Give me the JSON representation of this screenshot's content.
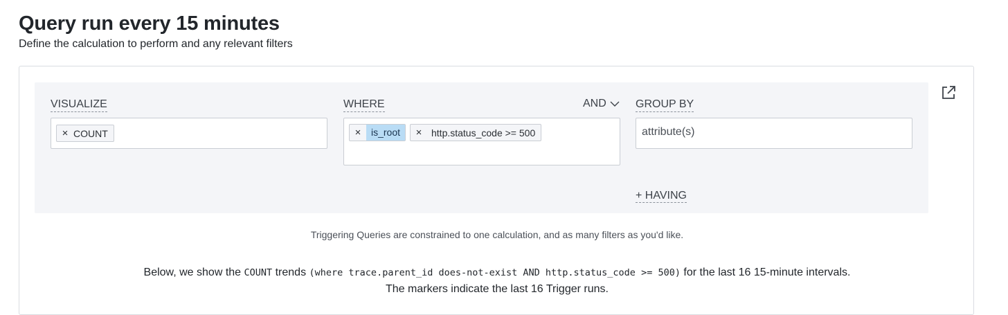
{
  "header": {
    "title": "Query run every 15 minutes",
    "subtitle": "Define the calculation to perform and any relevant filters"
  },
  "builder": {
    "visualize": {
      "label": "VISUALIZE",
      "pills": [
        {
          "remove": "×",
          "text": "COUNT"
        }
      ]
    },
    "where": {
      "label": "WHERE",
      "operator": "AND",
      "pills": [
        {
          "remove": "×",
          "text": "is_root"
        },
        {
          "remove": "×",
          "text": "http.status_code >= 500"
        }
      ]
    },
    "group_by": {
      "label": "GROUP BY",
      "placeholder": "attribute(s)"
    },
    "having_label": "+ HAVING",
    "open_icon": "external-link-icon"
  },
  "footer": {
    "note": "Triggering Queries are constrained to one calculation, and as many filters as you'd like.",
    "summary_prefix": "Below, we show the",
    "summary_calc": "COUNT",
    "summary_trends": "trends",
    "summary_query": "(where trace.parent_id does-not-exist AND http.status_code >= 500)",
    "summary_for": "for the last 16",
    "summary_interval": "15-minute intervals.",
    "summary_line2": "The markers indicate the last 16 Trigger runs."
  },
  "colors": {
    "panel_bg": "#f4f5f8",
    "pill_highlight": "#b9dcf5",
    "border": "#c9cdd3"
  }
}
